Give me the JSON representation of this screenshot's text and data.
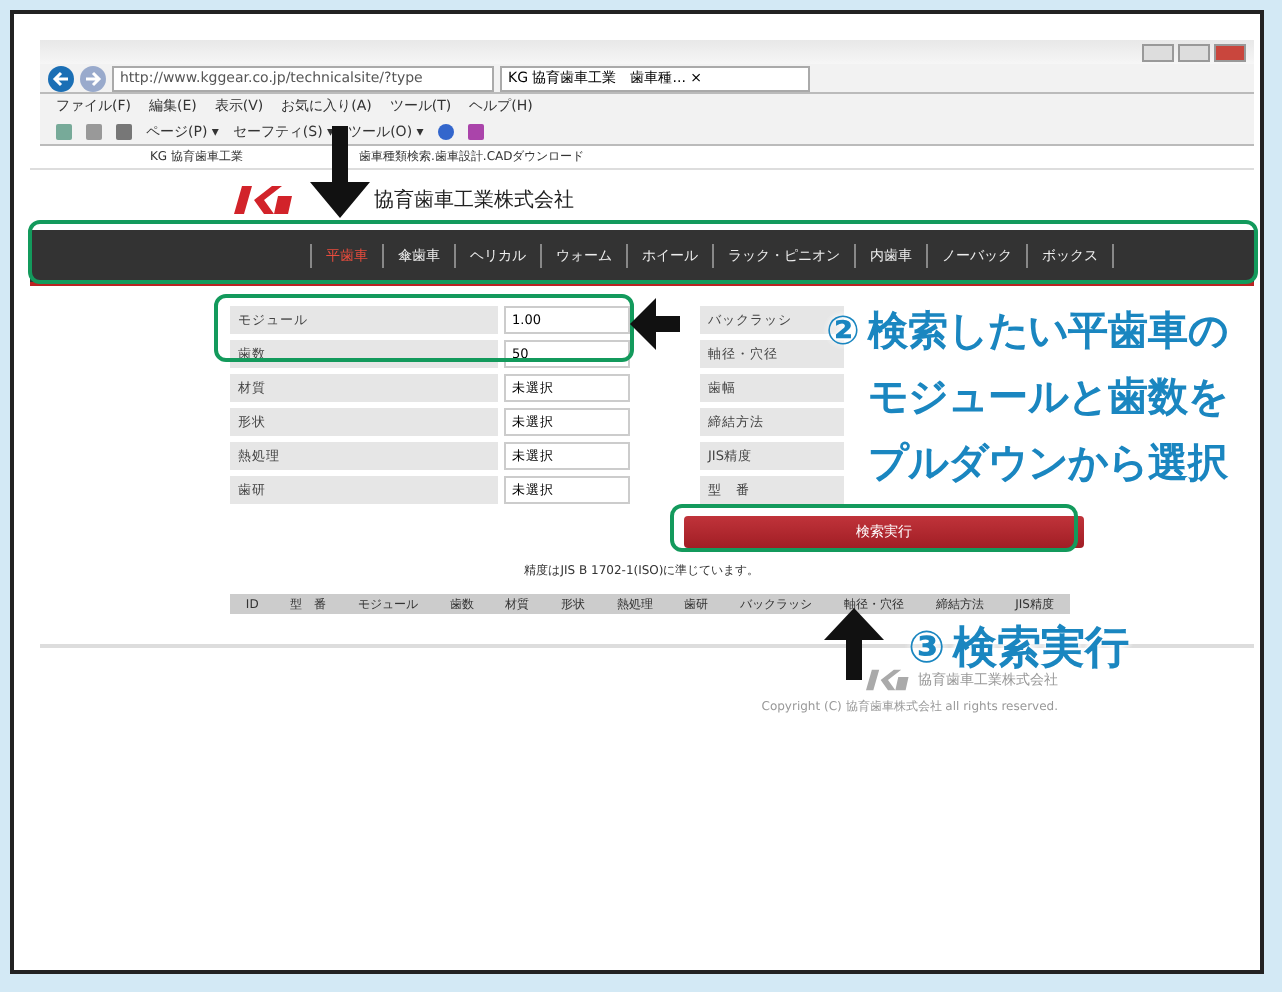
{
  "browser": {
    "address": "http://www.kggear.co.jp/technicalsite/?type",
    "tab": "KG 協育歯車工業　歯車種... ×",
    "menu": [
      "ファイル(F)",
      "編集(E)",
      "表示(V)",
      "お気に入り(A)",
      "ツール(T)",
      "ヘルプ(H)"
    ],
    "toolbar": [
      "ページ(P) ▾",
      "セーフティ(S) ▾",
      "ツール(O) ▾"
    ]
  },
  "site_header": {
    "left": "KG 協育歯車工業",
    "right": "歯車種類検索.歯車設計.CADダウンロード"
  },
  "company_name": "協育歯車工業株式会社",
  "nav": [
    {
      "label": "平歯車",
      "selected": true
    },
    {
      "label": "傘歯車",
      "selected": false
    },
    {
      "label": "ヘリカル",
      "selected": false
    },
    {
      "label": "ウォーム",
      "selected": false
    },
    {
      "label": "ホイール",
      "selected": false
    },
    {
      "label": "ラック・ピニオン",
      "selected": false
    },
    {
      "label": "内歯車",
      "selected": false
    },
    {
      "label": "ノーバック",
      "selected": false
    },
    {
      "label": "ボックス",
      "selected": false
    }
  ],
  "form_left": [
    {
      "label": "モジュール",
      "value": "1.00"
    },
    {
      "label": "歯数",
      "value": "50"
    },
    {
      "label": "材質",
      "value": "未選択"
    },
    {
      "label": "形状",
      "value": "未選択"
    },
    {
      "label": "熱処理",
      "value": "未選択"
    },
    {
      "label": "歯研",
      "value": "未選択"
    }
  ],
  "form_right": [
    {
      "label": "バックラッシ"
    },
    {
      "label": "軸径・穴径"
    },
    {
      "label": "歯幅"
    },
    {
      "label": "締結方法"
    },
    {
      "label": "JIS精度"
    },
    {
      "label": "型　番"
    }
  ],
  "search_button": "検索実行",
  "note": "精度はJIS B 1702-1(ISO)に準じています。",
  "table": {
    "columns": [
      "ID",
      "型　番",
      "モジュール",
      "歯数",
      "材質",
      "形状",
      "熱処理",
      "歯研",
      "バックラッシ",
      "軸径・穴径",
      "締結方法",
      "JIS精度"
    ]
  },
  "footer": {
    "company": "協育歯車工業株式会社",
    "copyright": "Copyright (C) 協育歯車株式会社 all rights reserved."
  },
  "annotations": [
    {
      "number": "②",
      "lines": [
        "検索したい平歯車の",
        "モジュールと歯数を",
        "プルダウンから選択"
      ]
    },
    {
      "number": "③",
      "lines": [
        "検索実行"
      ]
    }
  ]
}
